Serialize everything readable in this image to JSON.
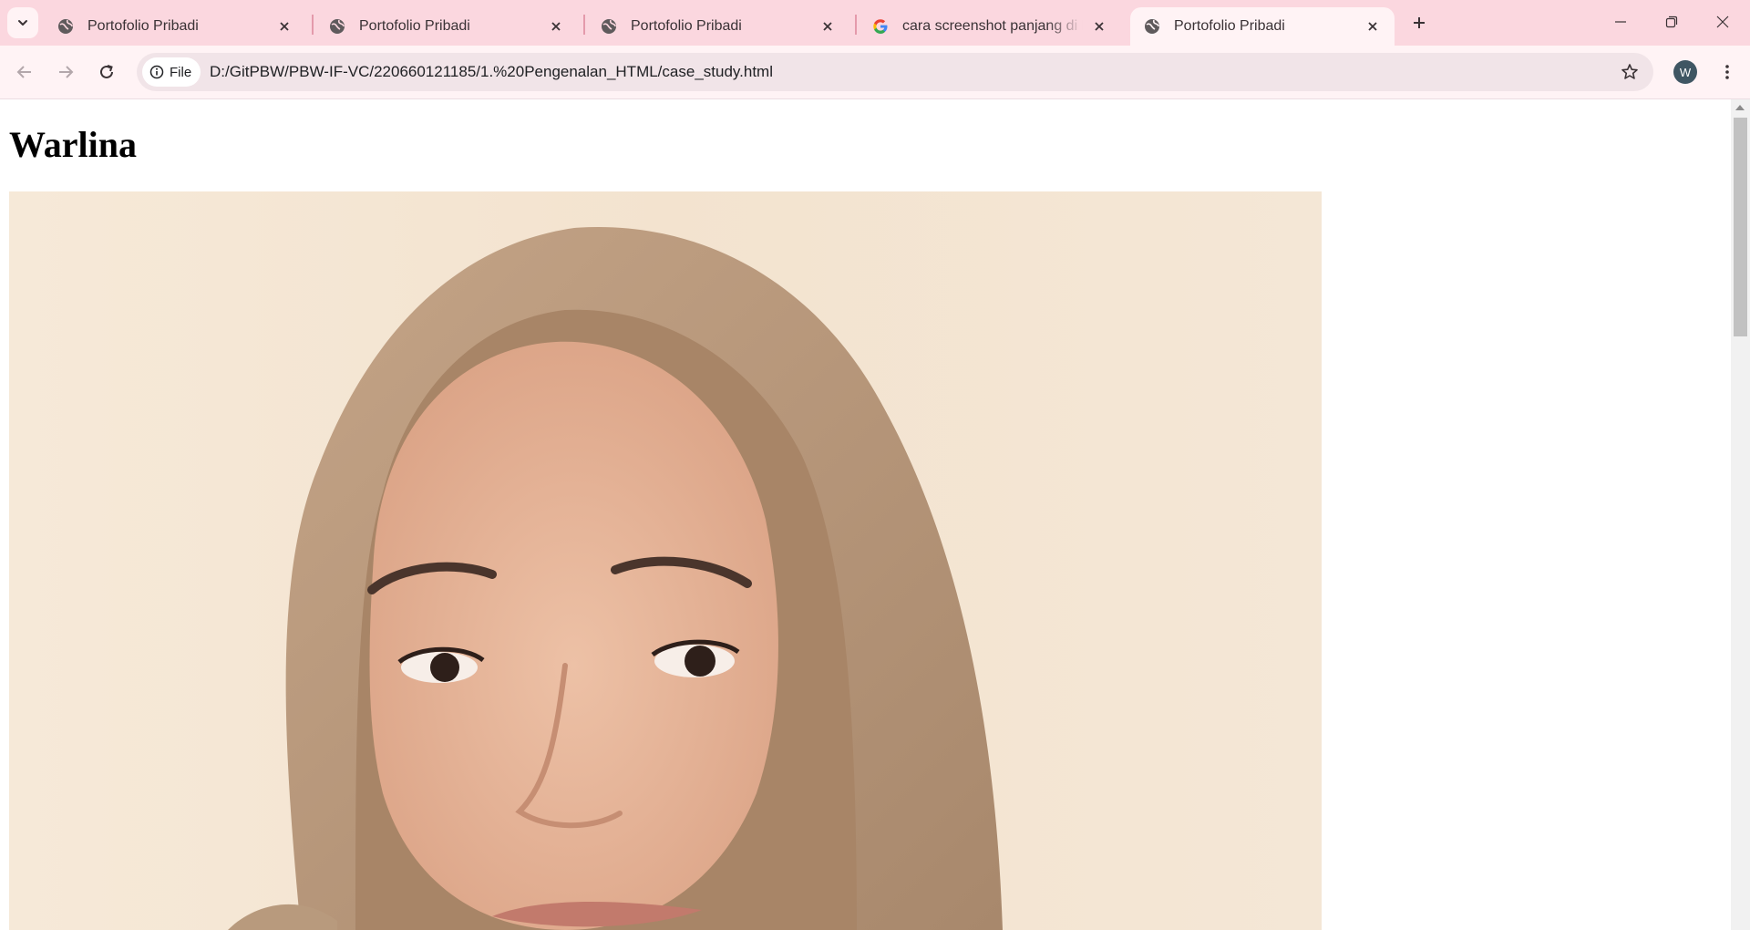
{
  "browser": {
    "tabs": [
      {
        "title": "Portofolio Pribadi",
        "favicon": "globe-icon",
        "active": false
      },
      {
        "title": "Portofolio Pribadi",
        "favicon": "globe-icon",
        "active": false
      },
      {
        "title": "Portofolio Pribadi",
        "favicon": "globe-icon",
        "active": false
      },
      {
        "title": "cara screenshot panjang di laptop",
        "favicon": "google-icon",
        "active": false
      },
      {
        "title": "Portofolio Pribadi",
        "favicon": "globe-icon",
        "active": true
      }
    ],
    "address": {
      "scheme_label": "File",
      "url": "D:/GitPBW/PBW-IF-VC/220660121185/1.%20Pengenalan_HTML/case_study.html"
    },
    "profile_initial": "W",
    "colors": {
      "tabstrip": "#fbd7df",
      "toolbar": "#fff3f5",
      "omnibox": "#f1e4e8"
    }
  },
  "page": {
    "heading": "Warlina",
    "photo": {
      "kind": "portrait photo",
      "description_colors": {
        "background": "#f3e4d0",
        "hijab": "#b5977a",
        "skin": "#e8b89c"
      }
    }
  }
}
